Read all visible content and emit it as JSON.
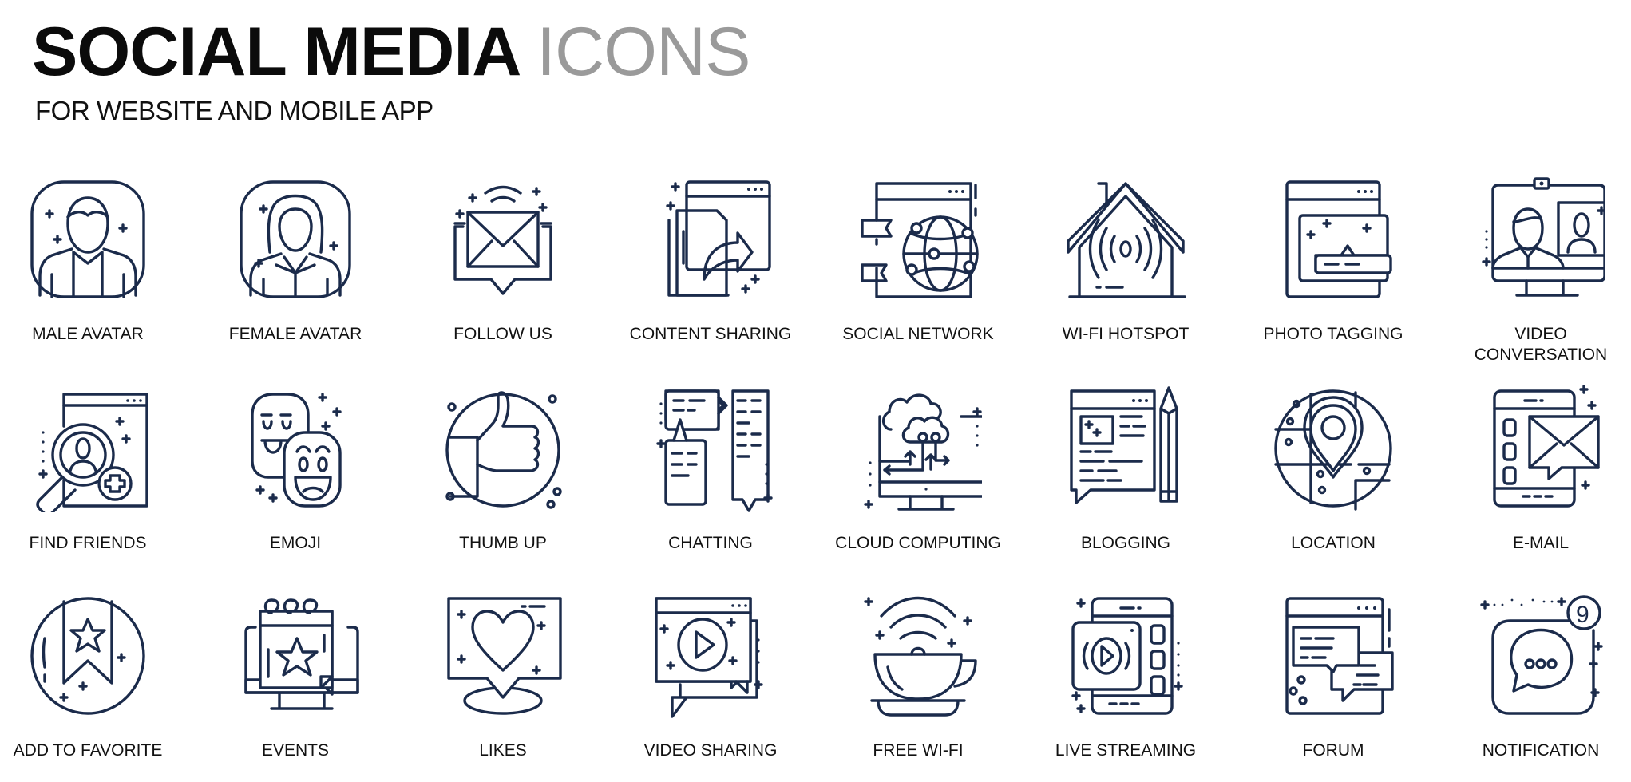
{
  "header": {
    "title_bold": "SOCIAL MEDIA",
    "title_light": "ICONS",
    "subtitle": "FOR WEBSITE AND MOBILE APP"
  },
  "colors": {
    "icon_stroke": "#1b2b4b",
    "title_dark": "#0b0b0b",
    "title_light": "#9a9a9a"
  },
  "icons": [
    {
      "label": "MALE AVATAR",
      "icon": "male-avatar-icon"
    },
    {
      "label": "FEMALE AVATAR",
      "icon": "female-avatar-icon"
    },
    {
      "label": "FOLLOW US",
      "icon": "follow-us-icon"
    },
    {
      "label": "CONTENT SHARING",
      "icon": "content-sharing-icon"
    },
    {
      "label": "SOCIAL NETWORK",
      "icon": "social-network-icon"
    },
    {
      "label": "WI-FI HOTSPOT",
      "icon": "wifi-hotspot-icon"
    },
    {
      "label": "PHOTO TAGGING",
      "icon": "photo-tagging-icon"
    },
    {
      "label": "VIDEO\nCONVERSATION",
      "icon": "video-conversation-icon"
    },
    {
      "label": "FIND FRIENDS",
      "icon": "find-friends-icon"
    },
    {
      "label": "EMOJI",
      "icon": "emoji-icon"
    },
    {
      "label": "THUMB UP",
      "icon": "thumb-up-icon"
    },
    {
      "label": "CHATTING",
      "icon": "chatting-icon"
    },
    {
      "label": "CLOUD COMPUTING",
      "icon": "cloud-computing-icon"
    },
    {
      "label": "BLOGGING",
      "icon": "blogging-icon"
    },
    {
      "label": "LOCATION",
      "icon": "location-icon"
    },
    {
      "label": "E-MAIL",
      "icon": "email-icon"
    },
    {
      "label": "ADD TO FAVORITE",
      "icon": "add-to-favorite-icon"
    },
    {
      "label": "EVENTS",
      "icon": "events-icon"
    },
    {
      "label": "LIKES",
      "icon": "likes-icon"
    },
    {
      "label": "VIDEO SHARING",
      "icon": "video-sharing-icon"
    },
    {
      "label": "FREE WI-FI",
      "icon": "free-wifi-icon"
    },
    {
      "label": "LIVE STREAMING",
      "icon": "live-streaming-icon"
    },
    {
      "label": "FORUM",
      "icon": "forum-icon"
    },
    {
      "label": "NOTIFICATION",
      "icon": "notification-icon"
    }
  ],
  "notification_badge": "9"
}
